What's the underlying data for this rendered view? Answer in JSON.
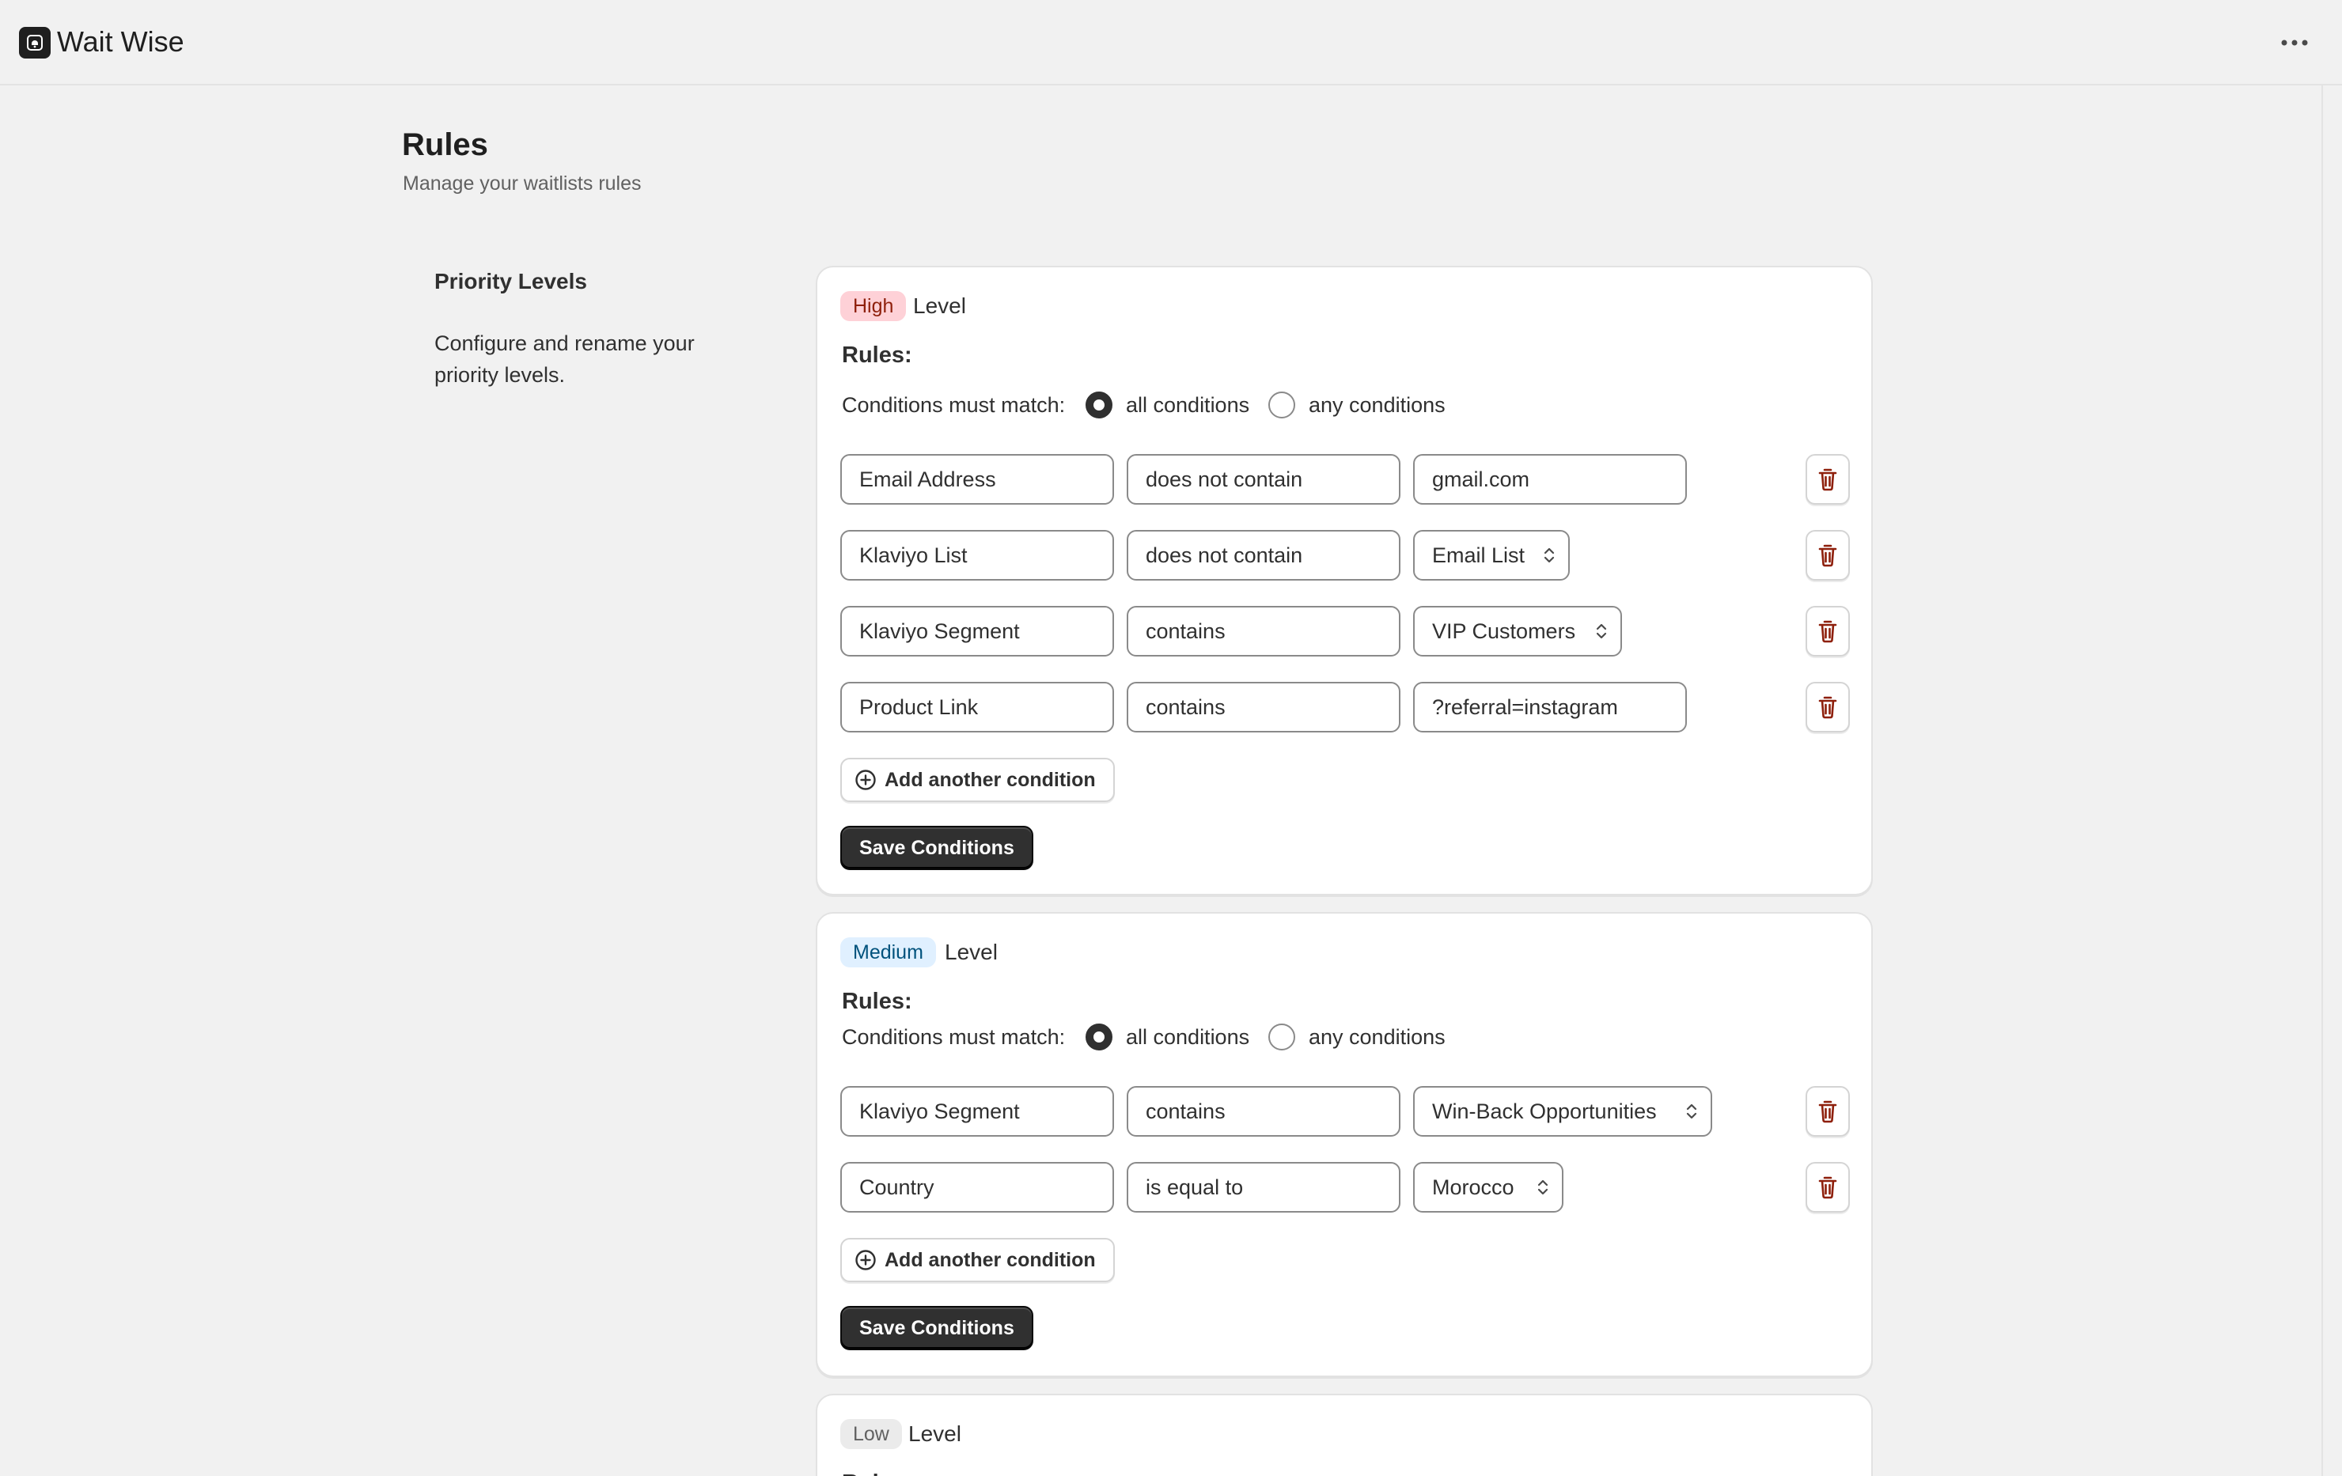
{
  "app": {
    "name": "Wait Wise"
  },
  "header": {
    "title": "Rules",
    "subtitle": "Manage your waitlists rules"
  },
  "section": {
    "title": "Priority Levels",
    "description": "Configure and rename your priority levels."
  },
  "levels": [
    {
      "badge": "High",
      "badge_bg": "#fed1d7",
      "badge_color": "#8e1f0b",
      "level_word": "Level",
      "rules_label": "Rules:",
      "match_label": "Conditions must match:",
      "option_all": "all conditions",
      "option_any": "any conditions",
      "selected": "all",
      "conditions": [
        {
          "field": "Email Address",
          "operator": "does not contain",
          "value": "gmail.com",
          "value_type": "text"
        },
        {
          "field": "Klaviyo List",
          "operator": "does not contain",
          "value": "Email List",
          "value_type": "select"
        },
        {
          "field": "Klaviyo Segment",
          "operator": "contains",
          "value": "VIP Customers",
          "value_type": "select"
        },
        {
          "field": "Product Link",
          "operator": "contains",
          "value": "?referral=instagram",
          "value_type": "text"
        }
      ],
      "add_label": "Add another condition",
      "save_label": "Save Conditions"
    },
    {
      "badge": "Medium",
      "badge_bg": "#e0f0ff",
      "badge_color": "#00527c",
      "level_word": "Level",
      "rules_label": "Rules:",
      "match_label": "Conditions must match:",
      "option_all": "all conditions",
      "option_any": "any conditions",
      "selected": "all",
      "conditions": [
        {
          "field": "Klaviyo Segment",
          "operator": "contains",
          "value": "Win-Back Opportunities",
          "value_type": "select"
        },
        {
          "field": "Country",
          "operator": "is equal to",
          "value": "Morocco",
          "value_type": "select"
        }
      ],
      "add_label": "Add another condition",
      "save_label": "Save Conditions"
    },
    {
      "badge": "Low",
      "badge_bg": "#ebebeb",
      "badge_color": "#616161",
      "level_word": "Level",
      "rules_label": "Rules:"
    }
  ]
}
